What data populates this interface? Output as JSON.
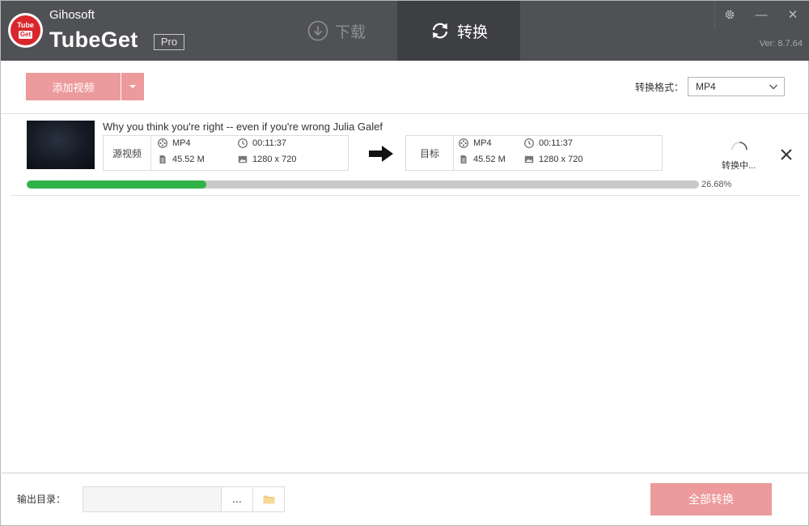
{
  "app": {
    "company": "Gihosoft",
    "name": "TubeGet",
    "edition": "Pro",
    "version": "Ver: 8.7.64"
  },
  "tabs": [
    {
      "label": "下载",
      "icon": "download-icon",
      "active": false
    },
    {
      "label": "转换",
      "icon": "convert-icon",
      "active": true
    }
  ],
  "window_controls": {
    "settings": "gear-icon",
    "minimize": "—",
    "close": "✕"
  },
  "toolbar": {
    "add_label": "添加视频",
    "format_label": "转换格式：",
    "format_value": "MP4"
  },
  "task": {
    "title": "Why you think you're right -- even if you're wrong  Julia Galef",
    "source": {
      "tag": "源视频",
      "format": "MP4",
      "duration": "00:11:37",
      "size": "45.52 M",
      "resolution": "1280 x 720"
    },
    "target": {
      "tag": "目标",
      "format": "MP4",
      "duration": "00:11:37",
      "size": "45.52 M",
      "resolution": "1280 x 720"
    },
    "status": "转换中...",
    "progress": 0.2668,
    "progress_text": "26.68%"
  },
  "footer": {
    "output_label": "输出目录：",
    "output_path": "",
    "browse_label": "...",
    "convert_all_label": "全部转换"
  },
  "colors": {
    "titlebar": "#505154",
    "active_tab": "#3e3f42",
    "accent": "#ec9a9c",
    "progress": "#2fb247"
  }
}
